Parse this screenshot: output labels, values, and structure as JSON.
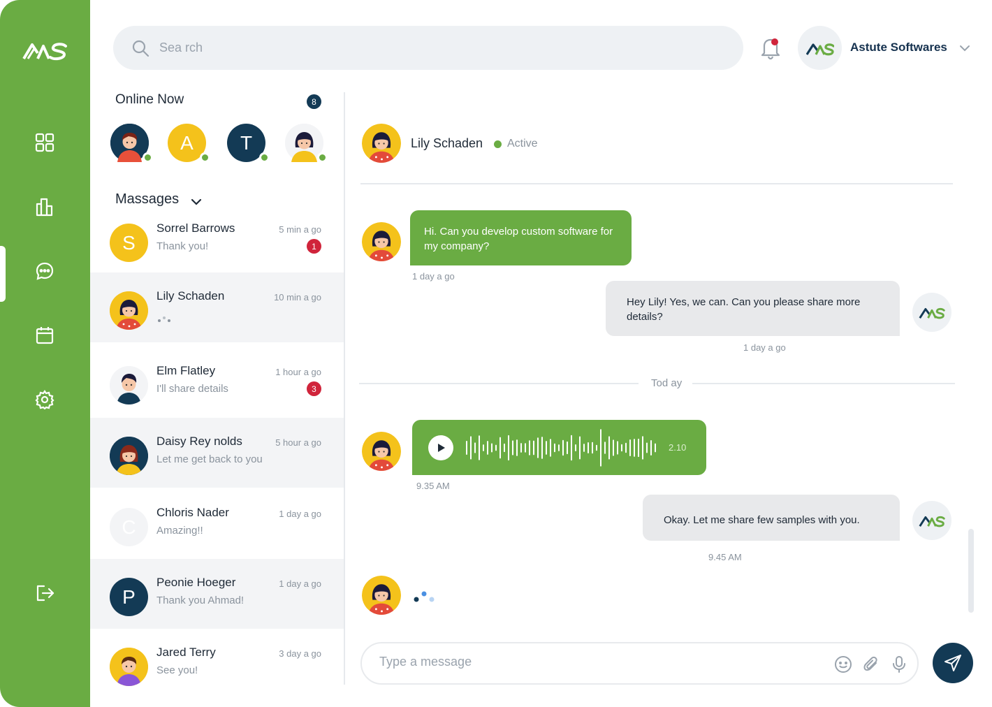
{
  "brand": {
    "logo": "AS"
  },
  "sidebar": {
    "items": [
      {
        "icon": "grid-icon",
        "label": "dashboard"
      },
      {
        "icon": "chart-icon",
        "label": "analytics"
      },
      {
        "icon": "chat-icon",
        "label": "messages"
      },
      {
        "icon": "calendar-icon",
        "label": "calendar"
      },
      {
        "icon": "gear-icon",
        "label": "settings"
      },
      {
        "icon": "logout-icon",
        "label": "logout"
      }
    ]
  },
  "search": {
    "placeholder": "Sea rch"
  },
  "profile": {
    "name": "Astute Softwares"
  },
  "online": {
    "title": "Online Now",
    "count": "8",
    "users": [
      {
        "initial": "",
        "color": "#133a55"
      },
      {
        "initial": "A",
        "color": "#f4c21b"
      },
      {
        "initial": "T",
        "color": "#133a55"
      },
      {
        "initial": "",
        "color": "#f3f4f6"
      }
    ]
  },
  "messages_header": {
    "title": "Massages"
  },
  "conversations": [
    {
      "initial": "S",
      "name": "Sorrel Barrows",
      "preview": "Thank you!",
      "time": "5 min a  go",
      "badge": "1"
    },
    {
      "initial": "",
      "name": "Lily  Schaden",
      "preview": "",
      "time": "10 min a  go",
      "badge": ""
    },
    {
      "initial": "",
      "name": "Elm  Flatley",
      "preview": "I'll share details",
      "time": "1 hour a  go",
      "badge": "3"
    },
    {
      "initial": "",
      "name": "Daisy  Rey nolds",
      "preview": "Let me get back to you",
      "time": "5  hour a  go",
      "badge": ""
    },
    {
      "initial": "C",
      "name": "Chloris Nader",
      "preview": "Amazing!!",
      "time": "1 day a  go",
      "badge": ""
    },
    {
      "initial": "P",
      "name": "Peonie Hoeger",
      "preview": "Thank you Ahmad!",
      "time": "1 day a  go",
      "badge": ""
    },
    {
      "initial": "",
      "name": "Jared  Terry",
      "preview": "See you!",
      "time": "3  day a  go",
      "badge": ""
    }
  ],
  "chat": {
    "contact_name": "Lily  Schaden",
    "status": "Active",
    "messages": [
      {
        "text": "Hi. Can you develop custom software for my company?",
        "time": "1 day a go"
      },
      {
        "text": "Hey Lily! Yes, we can. Can you please share more details?",
        "time": "1 day a go"
      },
      {
        "text": "Okay. Let me share few samples with you.",
        "time": "9.45  AM"
      }
    ],
    "today_label": "Tod ay",
    "voice": {
      "duration": "2.10",
      "time": "9.35  AM"
    }
  },
  "composer": {
    "placeholder": "Type a message"
  },
  "colors": {
    "brand_green": "#6aac43",
    "navy": "#133a55",
    "badge_red": "#d0243b"
  }
}
